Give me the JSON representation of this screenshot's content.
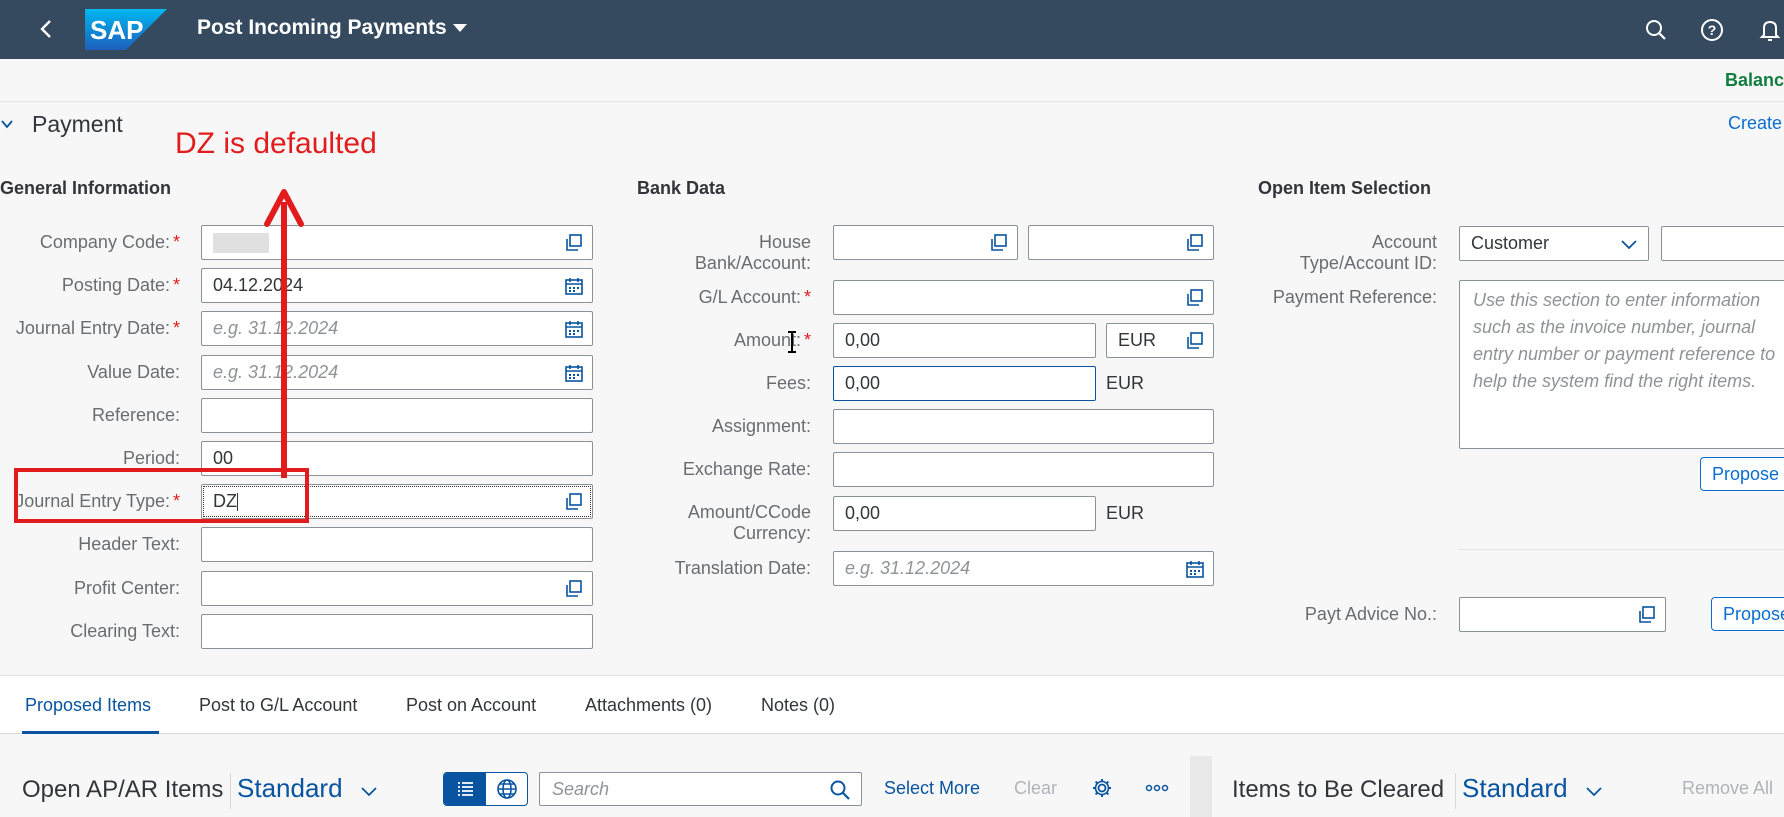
{
  "shell": {
    "title": "Post Incoming Payments",
    "logo_text": "SAP",
    "icons": [
      "back-icon",
      "search-icon",
      "help-icon",
      "notifications-icon"
    ]
  },
  "header": {
    "balance_label": "Balance",
    "create_label": "Create"
  },
  "section": {
    "title": "Payment"
  },
  "annotation": {
    "text": "DZ is defaulted",
    "color": "#e21c1c"
  },
  "general": {
    "title": "General Information",
    "company_code": {
      "label": "Company Code:",
      "value": ""
    },
    "posting_date": {
      "label": "Posting Date:",
      "value": "04.12.2024"
    },
    "journal_entry_date": {
      "label": "Journal Entry Date:",
      "placeholder": "e.g. 31.12.2024"
    },
    "value_date": {
      "label": "Value Date:",
      "placeholder": "e.g. 31.12.2024"
    },
    "reference": {
      "label": "Reference:",
      "value": ""
    },
    "period": {
      "label": "Period:",
      "value": "00"
    },
    "journal_entry_type": {
      "label": "Journal Entry Type:",
      "value": "DZ"
    },
    "header_text": {
      "label": "Header Text:",
      "value": ""
    },
    "profit_center": {
      "label": "Profit Center:",
      "value": ""
    },
    "clearing_text": {
      "label": "Clearing Text:",
      "value": ""
    }
  },
  "bank": {
    "title": "Bank Data",
    "house_bank_label_1": "House",
    "house_bank_label_2": "Bank/Account:",
    "gl_account_label": "G/L Account:",
    "amount_label": "Amount:",
    "amount_value": "0,00",
    "amount_currency": "EUR",
    "fees_label": "Fees:",
    "fees_value": "0,00",
    "fees_currency": "EUR",
    "assignment_label": "Assignment:",
    "exchange_rate_label": "Exchange Rate:",
    "ccode_label_1": "Amount/CCode",
    "ccode_label_2": "Currency:",
    "ccode_value": "0,00",
    "ccode_currency": "EUR",
    "translation_date_label": "Translation Date:",
    "translation_date_placeholder": "e.g. 31.12.2024"
  },
  "open_item": {
    "title": "Open Item Selection",
    "account_type_label_1": "Account",
    "account_type_label_2": "Type/Account ID:",
    "account_type_value": "Customer",
    "payment_reference_label": "Payment Reference:",
    "payment_reference_placeholder": "Use this section to enter information such as the invoice number, journal entry number or payment reference to help the system find the right items.",
    "propose_label": "Propose",
    "payt_advice_label": "Payt Advice No.:",
    "propose2_label": "Propose"
  },
  "tabs": [
    {
      "label": "Proposed Items",
      "active": true
    },
    {
      "label": "Post to G/L Account"
    },
    {
      "label": "Post on Account"
    },
    {
      "label": "Attachments (0)"
    },
    {
      "label": "Notes (0)"
    }
  ],
  "toolbar": {
    "open_items_title": "Open AP/AR Items",
    "variant": "Standard",
    "search_placeholder": "Search",
    "select_more": "Select More",
    "clear": "Clear",
    "items_to_clear_title": "Items to Be Cleared",
    "variant2": "Standard",
    "remove_all": "Remove All"
  },
  "colors": {
    "shell_bg": "#354a5f",
    "link": "#0a6ed1",
    "balance": "#107e3e",
    "required": "#e21c1c"
  }
}
